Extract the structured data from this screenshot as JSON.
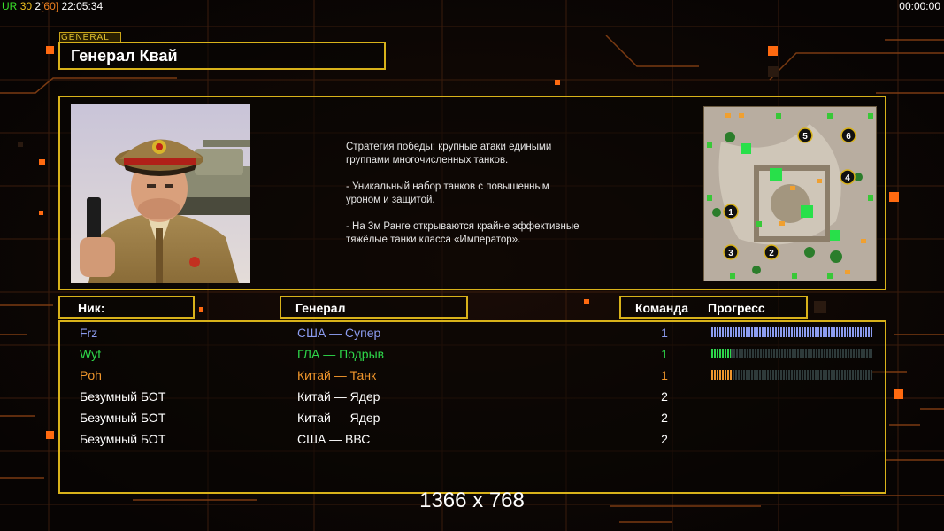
{
  "hud": {
    "label_ur": "UR",
    "val_a": "30",
    "val_b": "2",
    "val_c": "[60]",
    "clock": "22:05:34",
    "timer": "00:00:00"
  },
  "general_tag": "GENERAL",
  "general_name": "Генерал Квай",
  "description": [
    "Стратегия победы: крупные атаки едиными\n группами многочисленных танков.",
    "- Уникальный набор танков с повышенным\n уроном и защитой.",
    "- На 3м Ранге открываются крайне эффективные\n тяжёлые танки класса «Император»."
  ],
  "headers": {
    "nick": "Ник:",
    "general": "Генерал",
    "team": "Команда",
    "progress": "Прогресс"
  },
  "players": [
    {
      "nick": "Frz",
      "general": "США — Супер",
      "team": "1",
      "progress": 1.0,
      "color": "#8c9cf0"
    },
    {
      "nick": "Wyf",
      "general": "ГЛА — Подрыв",
      "team": "1",
      "progress": 0.12,
      "color": "#2ed64a"
    },
    {
      "nick": "Poh",
      "general": "Китай — Танк",
      "team": "1",
      "progress": 0.13,
      "color": "#f0962c"
    },
    {
      "nick": "Безумный БОТ",
      "general": "Китай — Ядер",
      "team": "2",
      "progress": null,
      "color": "#ffffff"
    },
    {
      "nick": "Безумный БОТ",
      "general": "Китай — Ядер",
      "team": "2",
      "progress": null,
      "color": "#ffffff"
    },
    {
      "nick": "Безумный БОТ",
      "general": "США — ВВС",
      "team": "2",
      "progress": null,
      "color": "#ffffff"
    }
  ],
  "minimap": {
    "start_positions": [
      "1",
      "2",
      "3",
      "4",
      "5",
      "6"
    ]
  },
  "colors": {
    "frame": "#d8b21a",
    "accent_orange": "#ff6a10",
    "hud_green": "#3adf2a"
  },
  "resolution": "1366 x 768"
}
